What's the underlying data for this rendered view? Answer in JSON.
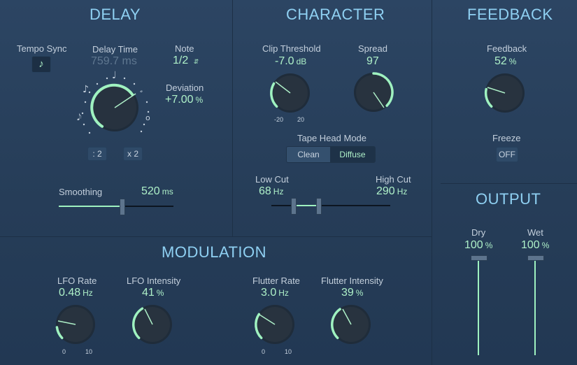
{
  "delay": {
    "title": "DELAY",
    "tempo_sync_label": "Tempo Sync",
    "delay_time_label": "Delay Time",
    "delay_time_value": "759.7 ms",
    "note_label": "Note",
    "note_value": "1/2",
    "deviation_label": "Deviation",
    "deviation_value": "+7.00",
    "deviation_unit": "%",
    "half_button": ": 2",
    "double_button": "x 2",
    "smoothing_label": "Smoothing",
    "smoothing_value": "520",
    "smoothing_unit": "ms",
    "smoothing_level": 0.55
  },
  "character": {
    "title": "CHARACTER",
    "clip_threshold_label": "Clip Threshold",
    "clip_threshold_value": "-7.0",
    "clip_threshold_unit": "dB",
    "clip_min": "-20",
    "clip_max": "20",
    "spread_label": "Spread",
    "spread_value": "97",
    "tape_head_mode_label": "Tape Head Mode",
    "tape_modes": [
      "Clean",
      "Diffuse"
    ],
    "tape_mode_selected": "Diffuse",
    "low_cut_label": "Low Cut",
    "low_cut_value": "68",
    "low_cut_unit": "Hz",
    "high_cut_label": "High Cut",
    "high_cut_value": "290",
    "high_cut_unit": "Hz"
  },
  "feedback": {
    "title": "FEEDBACK",
    "feedback_label": "Feedback",
    "feedback_value": "52",
    "feedback_unit": "%",
    "freeze_label": "Freeze",
    "freeze_value": "OFF"
  },
  "output": {
    "title": "OUTPUT",
    "dry_label": "Dry",
    "dry_value": "100",
    "dry_unit": "%",
    "wet_label": "Wet",
    "wet_value": "100",
    "wet_unit": "%"
  },
  "modulation": {
    "title": "MODULATION",
    "lfo_rate_label": "LFO Rate",
    "lfo_rate_value": "0.48",
    "lfo_rate_unit": "Hz",
    "lfo_rate_min": "0",
    "lfo_rate_max": "10",
    "lfo_intensity_label": "LFO Intensity",
    "lfo_intensity_value": "41",
    "lfo_intensity_unit": "%",
    "flutter_rate_label": "Flutter Rate",
    "flutter_rate_value": "3.0",
    "flutter_rate_unit": "Hz",
    "flutter_rate_min": "0",
    "flutter_rate_max": "10",
    "flutter_intensity_label": "Flutter Intensity",
    "flutter_intensity_value": "39",
    "flutter_intensity_unit": "%"
  },
  "colors": {
    "accent": "#9ff2c0",
    "title": "#8fd0f2",
    "background": "#2a4260"
  }
}
